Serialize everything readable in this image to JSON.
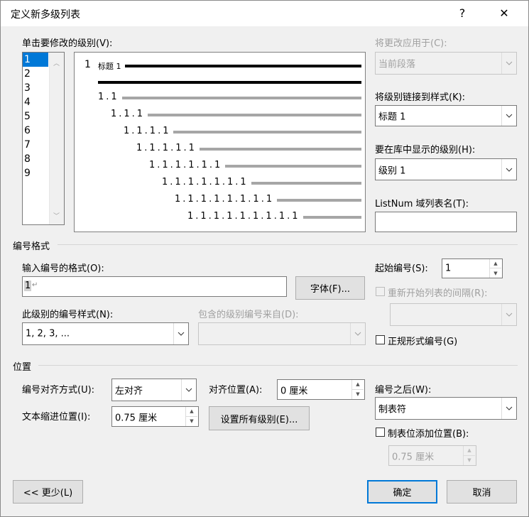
{
  "title": "定义新多级列表",
  "title_help": "?",
  "title_close": "✕",
  "click_level_label": "单击要修改的级别(V):",
  "levels": [
    "1",
    "2",
    "3",
    "4",
    "5",
    "6",
    "7",
    "8",
    "9"
  ],
  "preview": {
    "first_number": "1",
    "first_heading": "标题 1",
    "rows": [
      "1.1",
      "1.1.1",
      "1.1.1.1",
      "1.1.1.1.1",
      "1.1.1.1.1.1",
      "1.1.1.1.1.1.1",
      "1.1.1.1.1.1.1.1",
      "1.1.1.1.1.1.1.1.1"
    ]
  },
  "apply_changes_label": "将更改应用于(C):",
  "apply_changes_value": "当前段落",
  "link_level_label": "将级别链接到样式(K):",
  "link_level_value": "标题 1",
  "gallery_level_label": "要在库中显示的级别(H):",
  "gallery_level_value": "级别 1",
  "listnum_label": "ListNum 域列表名(T):",
  "listnum_value": "",
  "number_format_section": "编号格式",
  "enter_format_label": "输入编号的格式(O):",
  "enter_format_value": "1",
  "font_button": "字体(F)...",
  "number_style_label": "此级别的编号样式(N):",
  "number_style_value": "1, 2, 3, ...",
  "include_level_label": "包含的级别编号来自(D):",
  "include_level_value": "",
  "start_at_label": "起始编号(S):",
  "start_at_value": "1",
  "restart_label": "重新开始列表的间隔(R):",
  "restart_value": "",
  "legal_label": "正规形式编号(G)",
  "position_section": "位置",
  "alignment_label": "编号对齐方式(U):",
  "alignment_value": "左对齐",
  "aligned_at_label": "对齐位置(A):",
  "aligned_at_value": "0 厘米",
  "indent_label": "文本缩进位置(I):",
  "indent_value": "0.75 厘米",
  "set_all_button": "设置所有级别(E)...",
  "follow_label": "编号之后(W):",
  "follow_value": "制表符",
  "tab_stop_label": "制表位添加位置(B):",
  "tab_stop_value": "0.75 厘米",
  "less_button": "<< 更少(L)",
  "ok_button": "确定",
  "cancel_button": "取消"
}
